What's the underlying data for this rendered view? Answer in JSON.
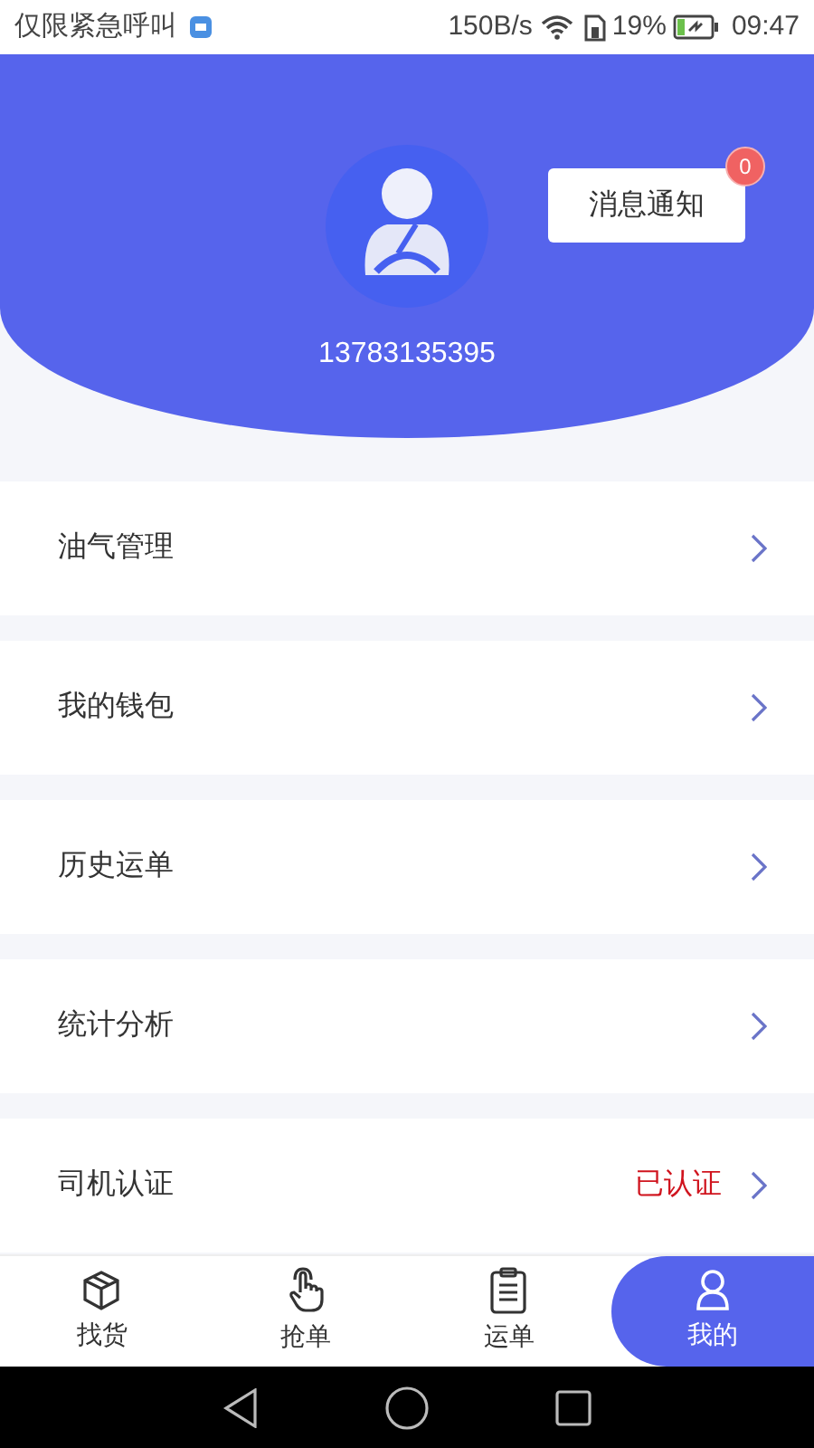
{
  "status_bar": {
    "carrier_text": "仅限紧急呼叫",
    "network_speed": "150B/s",
    "battery_percent": "19%",
    "time": "09:47"
  },
  "profile": {
    "phone": "13783135395",
    "notification_button": {
      "label": "消息通知",
      "badge": "0"
    }
  },
  "menu": [
    {
      "label": "油气管理"
    },
    {
      "label": "我的钱包"
    },
    {
      "label": "历史运单"
    },
    {
      "label": "统计分析"
    },
    {
      "label": "司机认证",
      "status": "已认证"
    }
  ],
  "tabs": [
    {
      "label": "找货",
      "kind": "box",
      "selected": false
    },
    {
      "label": "抢单",
      "kind": "hand",
      "selected": false
    },
    {
      "label": "运单",
      "kind": "clipboard",
      "selected": false
    },
    {
      "label": "我的",
      "kind": "person",
      "selected": true
    }
  ]
}
